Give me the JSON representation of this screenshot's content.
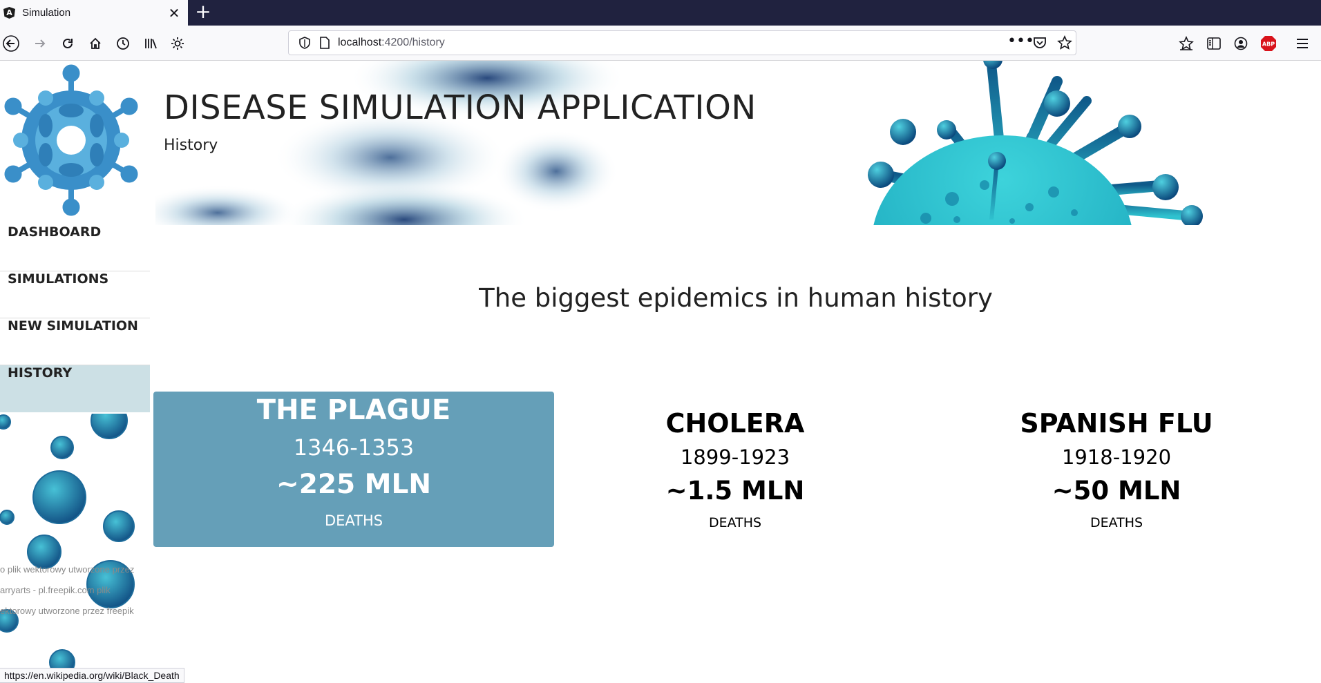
{
  "browser": {
    "tab_title": "Simulation",
    "favicon_letter": "A",
    "url_host": "localhost",
    "url_path": ":4200/history",
    "status_url": "https://en.wikipedia.org/wiki/Black_Death"
  },
  "header": {
    "title": "DISEASE SIMULATION APPLICATION",
    "subtitle": "History"
  },
  "sidebar": {
    "items": [
      {
        "label": "DASHBOARD",
        "active": false
      },
      {
        "label": "SIMULATIONS",
        "active": false
      },
      {
        "label": "NEW SIMULATION",
        "active": false
      },
      {
        "label": "HISTORY",
        "active": true
      }
    ],
    "credits": [
      "o plik wektorowy utworzone przez",
      "arryarts - pl.freepik.com plik",
      "ektorowy utworzone przez freepik"
    ]
  },
  "main": {
    "title": "The biggest epidemics in human history",
    "epidemics": [
      {
        "name": "THE PLAGUE",
        "years": "1346-1353",
        "deaths": "~225 MLN",
        "deaths_label": "DEATHS",
        "active": true
      },
      {
        "name": "CHOLERA",
        "years": "1899-1923",
        "deaths": "~1.5 MLN",
        "deaths_label": "DEATHS",
        "active": false
      },
      {
        "name": "SPANISH FLU",
        "years": "1918-1920",
        "deaths": "~50 MLN",
        "deaths_label": "DEATHS",
        "active": false
      }
    ]
  },
  "colors": {
    "accent": "#659fb8",
    "active_nav": "#cce0e5",
    "virus_teal": "#2fc2cf",
    "logo_blue": "#3a8fc9"
  }
}
